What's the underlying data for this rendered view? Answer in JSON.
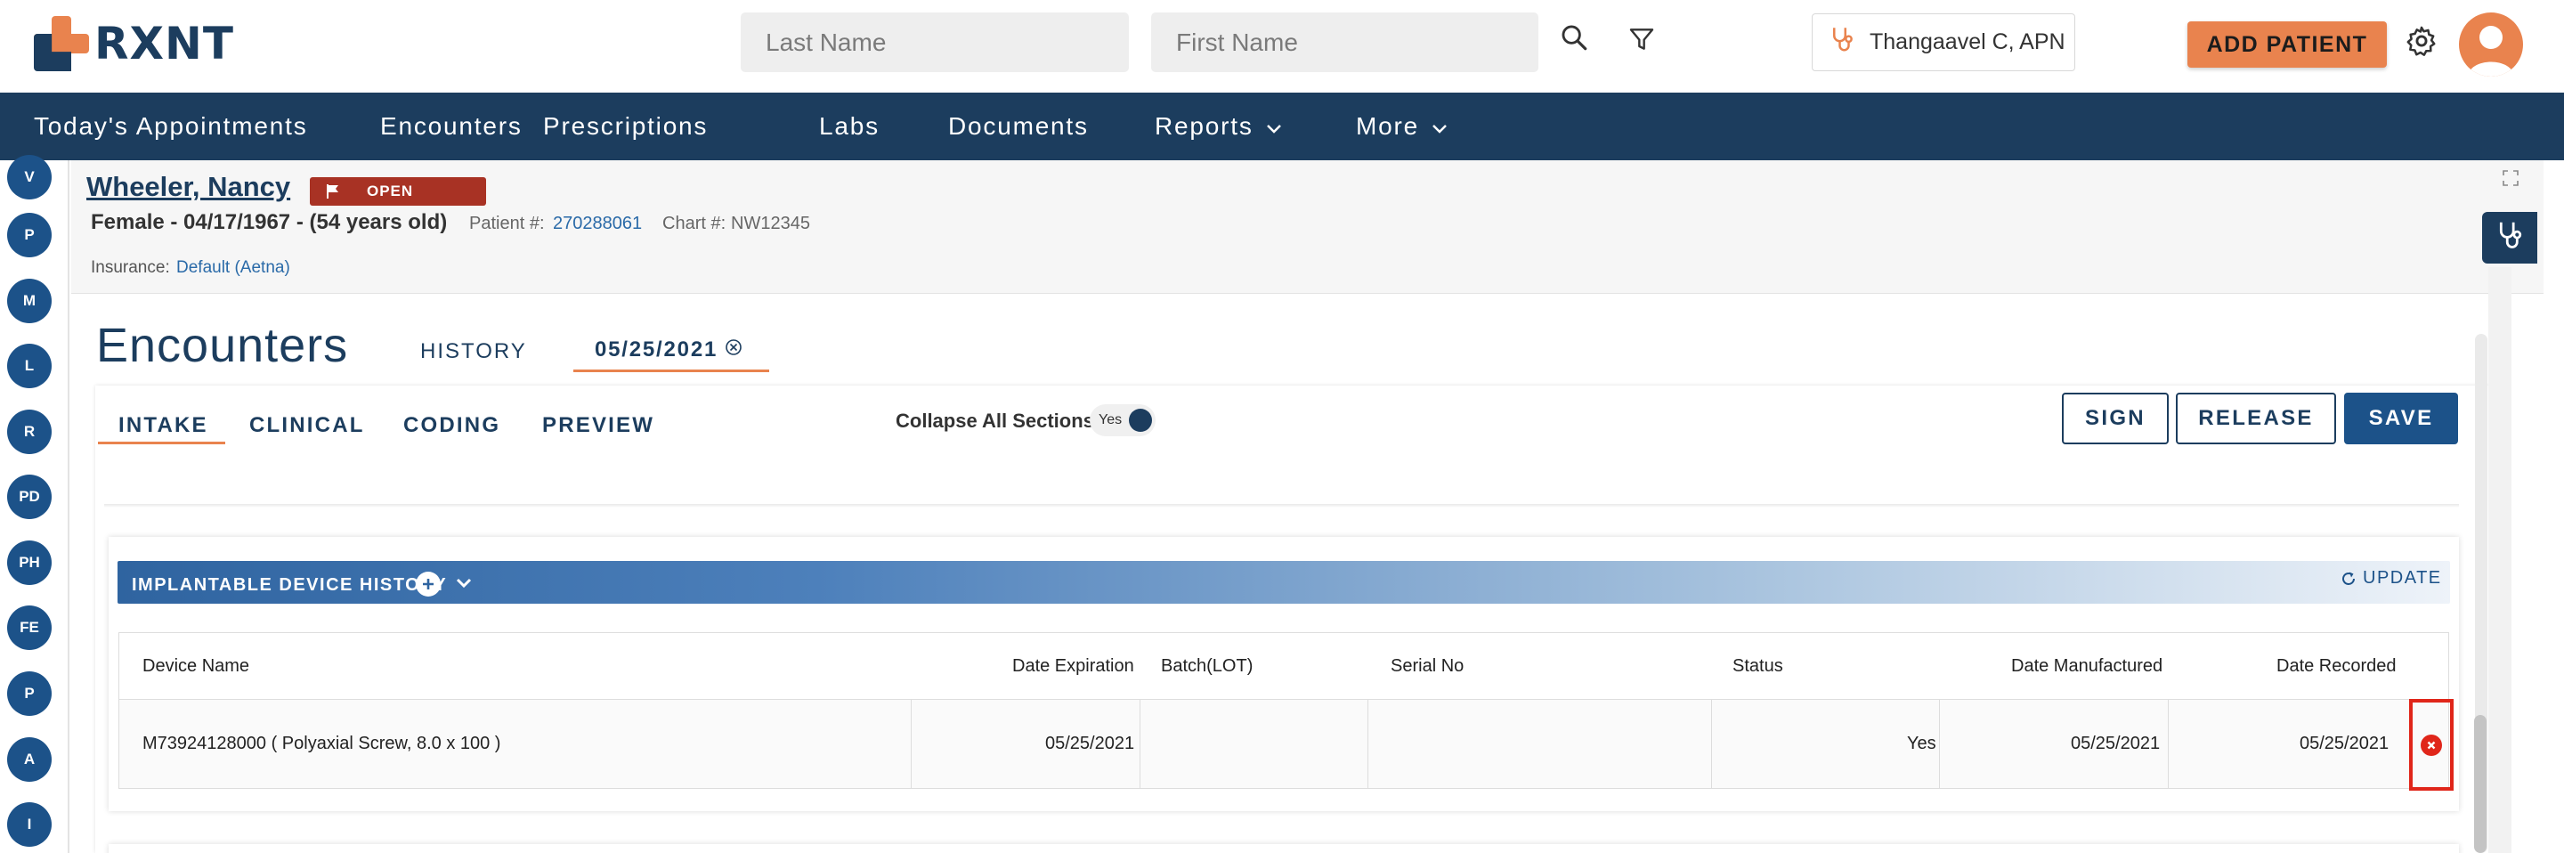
{
  "brand": {
    "logo_text": "RXNT",
    "accent": "#e9834e",
    "primary": "#1c3d5e"
  },
  "search": {
    "last_name_placeholder": "Last Name",
    "first_name_placeholder": "First Name"
  },
  "provider": {
    "name": "Thangaavel C, APN"
  },
  "add_patient_label": "ADD PATIENT",
  "nav": {
    "items": [
      {
        "label": "Today's Appointments"
      },
      {
        "label": "Encounters"
      },
      {
        "label": "Prescriptions"
      },
      {
        "label": "Labs"
      },
      {
        "label": "Documents"
      },
      {
        "label": "Reports"
      },
      {
        "label": "More"
      }
    ]
  },
  "rail": {
    "items": [
      "V",
      "P",
      "M",
      "L",
      "R",
      "PD",
      "PH",
      "FE",
      "P",
      "A",
      "I"
    ]
  },
  "patient": {
    "name": "Wheeler, Nancy",
    "status": "OPEN",
    "demographics": "Female - 04/17/1967 - (54 years old)",
    "patient_number_label": "Patient #:",
    "patient_number": "270288061",
    "chart_number_label": "Chart #:",
    "chart_number": "NW12345",
    "insurance_label": "Insurance:",
    "insurance": "Default (Aetna)"
  },
  "encounters": {
    "title": "Encounters",
    "history_tab": "HISTORY",
    "date_tab": "05/25/2021",
    "subtabs": [
      "INTAKE",
      "CLINICAL",
      "CODING",
      "PREVIEW"
    ],
    "collapse_label": "Collapse All Sections:",
    "collapse_value": "Yes",
    "sign_label": "SIGN",
    "release_label": "RELEASE",
    "save_label": "SAVE"
  },
  "device_history": {
    "title": "IMPLANTABLE DEVICE HISTORY",
    "update_label": "UPDATE",
    "columns": [
      "Device Name",
      "Date Expiration",
      "Batch(LOT)",
      "Serial No",
      "Status",
      "Date Manufactured",
      "Date Recorded"
    ],
    "rows": [
      {
        "device_name": "M73924128000 ( Polyaxial Screw, 8.0 x 100 )",
        "date_expiration": "05/25/2021",
        "batch_lot": "",
        "serial_no": "",
        "status": "Yes",
        "date_manufactured": "05/25/2021",
        "date_recorded": "05/25/2021"
      }
    ]
  }
}
